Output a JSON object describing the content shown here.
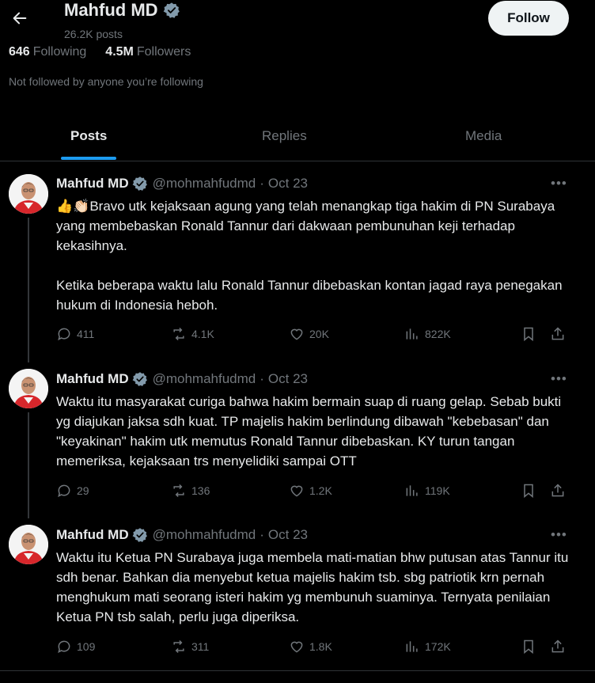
{
  "profile": {
    "name": "Mahfud MD",
    "posts_count": "26.2K posts",
    "follow_label": "Follow",
    "following_num": "646",
    "following_label": "Following",
    "followers_num": "4.5M",
    "followers_label": "Followers",
    "not_followed": "Not followed by anyone you’re following"
  },
  "tabs": [
    {
      "label": "Posts",
      "active": true
    },
    {
      "label": "Replies",
      "active": false
    },
    {
      "label": "Media",
      "active": false
    }
  ],
  "tweets": [
    {
      "name": "Mahfud MD",
      "handle": "@mohmahfudmd",
      "date": "Oct 23",
      "emoji": "👍👏🏻",
      "text": "Bravo utk kejaksaan agung yang telah menangkap tiga hakim di PN Surabaya yang membebaskan Ronald Tannur dari dakwaan pembunuhan keji terhadap kekasihnya.\n\nKetika beberapa waktu lalu Ronald Tannur dibebaskan kontan jagad raya penegakan hukum di Indonesia heboh.",
      "replies": "411",
      "reposts": "4.1K",
      "likes": "20K",
      "views": "822K"
    },
    {
      "name": "Mahfud MD",
      "handle": "@mohmahfudmd",
      "date": "Oct 23",
      "text": "Waktu itu masyarakat curiga bahwa hakim bermain suap di ruang gelap. Sebab bukti yg diajukan jaksa sdh kuat. TP majelis hakim berlindung dibawah \"kebebasan\" dan \"keyakinan\" hakim utk memutus Ronald Tannur dibebaskan. KY turun tangan memeriksa, kejaksaan trs menyelidiki sampai OTT",
      "replies": "29",
      "reposts": "136",
      "likes": "1.2K",
      "views": "119K"
    },
    {
      "name": "Mahfud MD",
      "handle": "@mohmahfudmd",
      "date": "Oct 23",
      "text": "Waktu itu Ketua PN Surabaya juga membela mati-matian bhw putusan atas Tannur itu sdh benar. Bahkan dia menyebut ketua majelis hakim tsb. sbg patriotik krn pernah menghukum mati seorang isteri hakim yg membunuh suaminya. Ternyata penilaian Ketua PN tsb salah, perlu juga diperiksa.",
      "replies": "109",
      "reposts": "311",
      "likes": "1.8K",
      "views": "172K"
    }
  ],
  "colors": {
    "background": "#000000",
    "text": "#e7e9ea",
    "muted": "#71767b",
    "accent": "#1d9bf0",
    "divider": "#2f3336"
  }
}
